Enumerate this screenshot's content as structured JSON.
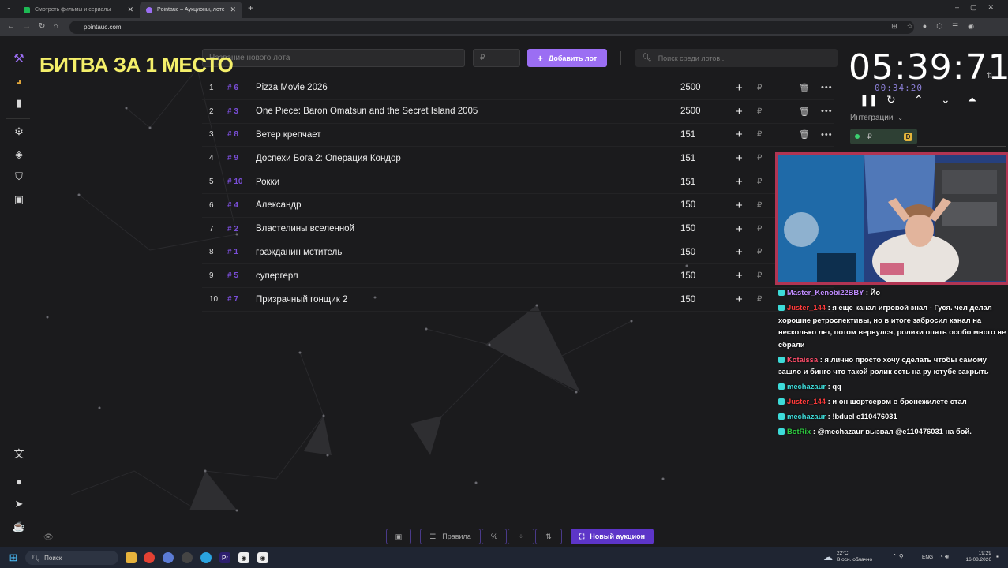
{
  "browser": {
    "tabs": [
      {
        "title": "Смотреть фильмы и сериалы",
        "active": false
      },
      {
        "title": "Pointauc – Аукционы, лотере",
        "active": true
      }
    ],
    "new_tab": "+",
    "url": "pointauc.com"
  },
  "overlay_title": "БИТВА ЗА 1 МЕСТО",
  "toolbar": {
    "new_lot_placeholder": "Название нового лота",
    "amount_placeholder": "₽",
    "add_lot_label": "Добавить лот",
    "search_placeholder": "Поиск среди лотов..."
  },
  "lots": [
    {
      "rank": "1",
      "tag": "# 6",
      "name": "Pizza Movie 2026",
      "amount": "2500"
    },
    {
      "rank": "2",
      "tag": "# 3",
      "name": "One Piece: Baron Omatsuri and the Secret Island 2005",
      "amount": "2500"
    },
    {
      "rank": "3",
      "tag": "# 8",
      "name": "Ветер крепчает",
      "amount": "151"
    },
    {
      "rank": "4",
      "tag": "# 9",
      "name": "Доспехи Бога 2: Операция Кондор",
      "amount": "151"
    },
    {
      "rank": "5",
      "tag": "# 10",
      "name": "Рокки",
      "amount": "151"
    },
    {
      "rank": "6",
      "tag": "# 4",
      "name": "Александр",
      "amount": "150"
    },
    {
      "rank": "7",
      "tag": "# 2",
      "name": "Властелины вселенной",
      "amount": "150"
    },
    {
      "rank": "8",
      "tag": "# 1",
      "name": "гражданин мститель",
      "amount": "150"
    },
    {
      "rank": "9",
      "tag": "# 5",
      "name": "супергерл",
      "amount": "150"
    },
    {
      "rank": "10",
      "tag": "# 7",
      "name": "Призрачный гонщик 2",
      "amount": "150"
    }
  ],
  "lot_currency": "₽",
  "timer": {
    "main": "05:39:71",
    "sub": "00:34:20"
  },
  "integrations": {
    "label": "Интеграции",
    "currency": "₽",
    "badge": "D"
  },
  "chat": [
    {
      "user": "Master_Kenobi22BBY",
      "color": "#c08cff",
      "text": "Йо"
    },
    {
      "user": "Juster_144",
      "color": "#ff3b3b",
      "text": "я еще канал игровой знал - Гуся. чел делал хорошие ретроспективы, но в итоге забросил канал на несколько лет, потом вернулся, ролики опять особо много не сбрали"
    },
    {
      "user": "Kotaissa",
      "color": "#ff4d6a",
      "text": "я лично просто хочу сделать чтобы самому зашло и бинго что такой ролик есть на ру ютубе закрыть"
    },
    {
      "user": "mechazaur",
      "color": "#3ddbd9",
      "text": "qq"
    },
    {
      "user": "Juster_144",
      "color": "#ff3b3b",
      "text": "и он шортсером в бронежилете стал"
    },
    {
      "user": "mechazaur",
      "color": "#3ddbd9",
      "text": "!bduel e110476031"
    },
    {
      "user": "BotRix",
      "color": "#2ecc40",
      "text": "@mechazaur вызвал @e110476031 на бой."
    }
  ],
  "bottom": {
    "rules_label": "Правила",
    "percent_label": "%",
    "new_auction_label": "Новый аукцион"
  },
  "taskbar": {
    "search_label": "Поиск",
    "weather_temp": "22°C",
    "weather_desc": "В осн. облачно",
    "lang": "ENG",
    "time": "19:29",
    "date": "16.08.2026"
  }
}
